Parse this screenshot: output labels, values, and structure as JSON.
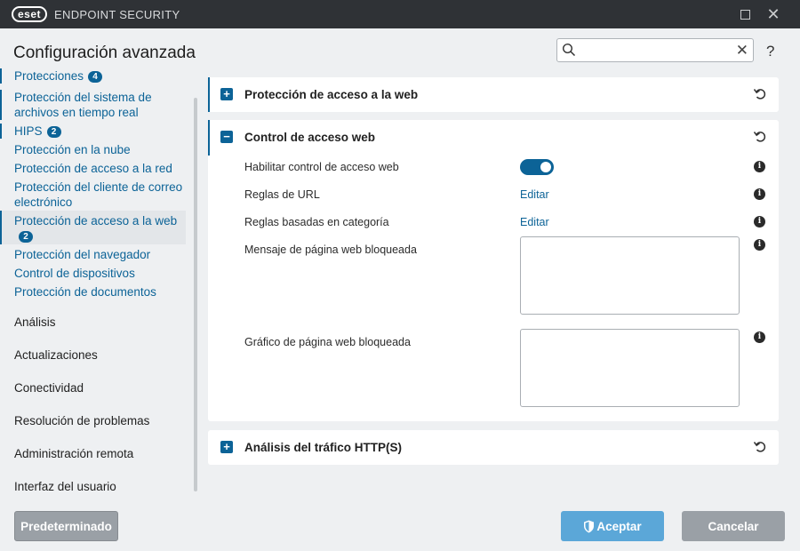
{
  "window": {
    "logo": "eset",
    "product": "ENDPOINT SECURITY"
  },
  "header": {
    "title": "Configuración avanzada",
    "search": {
      "value": "",
      "placeholder": ""
    },
    "help": "?"
  },
  "sidebar": {
    "sub_items": [
      {
        "label": "Protecciones",
        "badge": "4"
      },
      {
        "label": "Protección del sistema de archivos en tiempo real",
        "badge": ""
      },
      {
        "label": "HIPS",
        "badge": "2"
      },
      {
        "label": "Protección en la nube",
        "badge": ""
      },
      {
        "label": "Protección de acceso a la red",
        "badge": ""
      },
      {
        "label": "Protección del cliente de correo electrónico",
        "badge": ""
      },
      {
        "label": "Protección de acceso a la web",
        "badge": "2"
      },
      {
        "label": "Protección del navegador",
        "badge": ""
      },
      {
        "label": "Control de dispositivos",
        "badge": ""
      },
      {
        "label": "Protección de documentos",
        "badge": ""
      }
    ],
    "main_items": [
      {
        "label": "Análisis"
      },
      {
        "label": "Actualizaciones"
      },
      {
        "label": "Conectividad"
      },
      {
        "label": "Resolución de problemas"
      },
      {
        "label": "Administración remota"
      },
      {
        "label": "Interfaz del usuario"
      }
    ]
  },
  "sections": {
    "web_access": {
      "title": "Protección de acceso a la web",
      "expander": "+"
    },
    "web_control": {
      "title": "Control de acceso web",
      "expander": "−",
      "settings": {
        "enable": {
          "label": "Habilitar control de acceso web",
          "enabled": true
        },
        "url_rules": {
          "label": "Reglas de URL",
          "link": "Editar"
        },
        "category_rules": {
          "label": "Reglas basadas en categoría",
          "link": "Editar"
        },
        "blocked_message": {
          "label": "Mensaje de página web bloqueada",
          "value": ""
        },
        "blocked_graphic": {
          "label": "Gráfico de página web bloqueada",
          "value": ""
        }
      }
    },
    "http_scan": {
      "title": "Análisis del tráfico HTTP(S)",
      "expander": "+"
    }
  },
  "footer": {
    "default_label": "Predeterminado",
    "accept_label": "Aceptar",
    "cancel_label": "Cancelar"
  },
  "colors": {
    "accent": "#0c6397",
    "titlebar": "#2f3236",
    "accept_button": "#5ba7d8",
    "neutral_button": "#9aa0a6"
  },
  "icons": [
    "search-icon",
    "clear-icon",
    "help-icon",
    "plus-icon",
    "minus-icon",
    "reset-icon",
    "info-icon",
    "shield-icon"
  ]
}
